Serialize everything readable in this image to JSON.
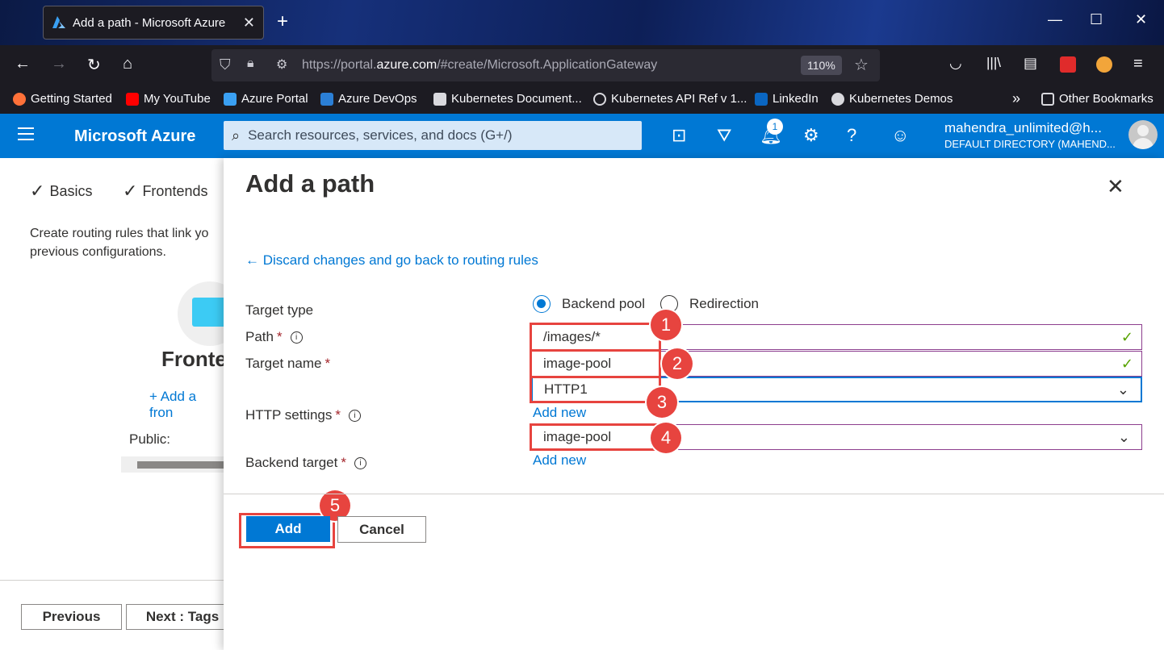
{
  "browser": {
    "tab_title": "Add a path - Microsoft Azure",
    "url_prefix": "https://portal.",
    "url_domain": "azure.com",
    "url_path": "/#create/Microsoft.ApplicationGateway",
    "zoom": "110%",
    "bookmarks": [
      {
        "label": "Getting Started"
      },
      {
        "label": "My YouTube"
      },
      {
        "label": "Azure Portal"
      },
      {
        "label": "Azure DevOps"
      },
      {
        "label": "Kubernetes Document..."
      },
      {
        "label": "Kubernetes API Ref v 1..."
      },
      {
        "label": "LinkedIn"
      },
      {
        "label": "Kubernetes Demos"
      }
    ],
    "other_bookmarks": "Other Bookmarks"
  },
  "azure": {
    "brand": "Microsoft Azure",
    "search_placeholder": "Search resources, services, and docs (G+/)",
    "notification_count": "1",
    "user_name": "mahendra_unlimited@h...",
    "user_directory": "DEFAULT DIRECTORY (MAHEND..."
  },
  "background_page": {
    "steps": [
      "Basics",
      "Frontends"
    ],
    "intro_line1": "Create routing rules that link yo",
    "intro_line2": "previous configurations.",
    "frontends_title": "Fronte",
    "add_frontend": "+ Add a fron",
    "public_label": "Public:",
    "previous_button": "Previous",
    "next_button": "Next : Tags"
  },
  "panel": {
    "title": "Add a path",
    "discard_link": "← Discard changes and go back to routing rules",
    "target_type_label": "Target type",
    "target_type_options": [
      {
        "label": "Backend pool",
        "selected": true
      },
      {
        "label": "Redirection",
        "selected": false
      }
    ],
    "path_label": "Path",
    "path_value": "/images/*",
    "target_name_label": "Target name",
    "target_name_value": "image-pool",
    "http_settings_label": "HTTP settings",
    "http_settings_value": "HTTP1",
    "backend_target_label": "Backend target",
    "backend_target_value": "image-pool",
    "add_new": "Add new",
    "required_mark": "*",
    "info_mark": "i",
    "add_button": "Add",
    "cancel_button": "Cancel"
  },
  "annotations": {
    "markers": [
      "1",
      "2",
      "3",
      "4",
      "5"
    ],
    "highlight_color": "#e7443f"
  },
  "colors": {
    "azure_blue": "#0078d4",
    "valid_check": "#57a300",
    "required": "#a4262c"
  }
}
